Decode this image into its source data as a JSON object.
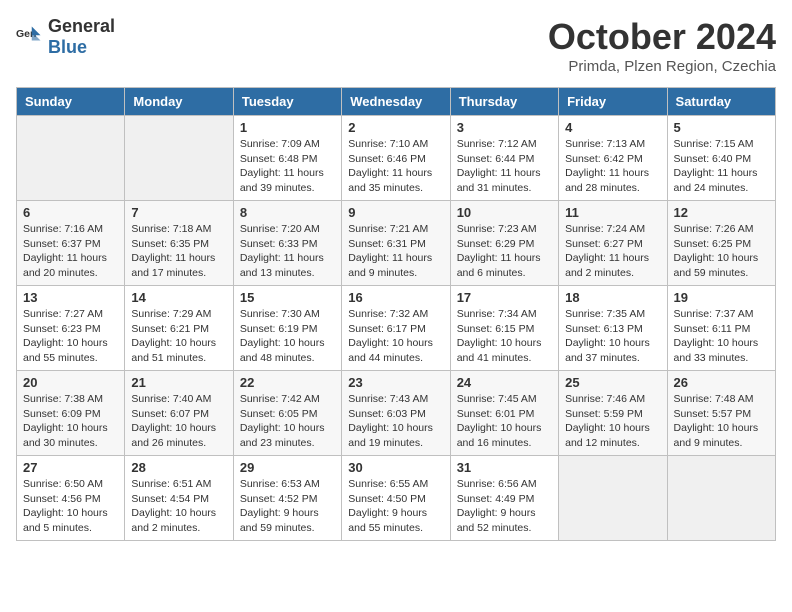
{
  "logo": {
    "general": "General",
    "blue": "Blue"
  },
  "header": {
    "title": "October 2024",
    "subtitle": "Primda, Plzen Region, Czechia"
  },
  "weekdays": [
    "Sunday",
    "Monday",
    "Tuesday",
    "Wednesday",
    "Thursday",
    "Friday",
    "Saturday"
  ],
  "weeks": [
    [
      {
        "day": "",
        "sunrise": "",
        "sunset": "",
        "daylight": ""
      },
      {
        "day": "",
        "sunrise": "",
        "sunset": "",
        "daylight": ""
      },
      {
        "day": "1",
        "sunrise": "Sunrise: 7:09 AM",
        "sunset": "Sunset: 6:48 PM",
        "daylight": "Daylight: 11 hours and 39 minutes."
      },
      {
        "day": "2",
        "sunrise": "Sunrise: 7:10 AM",
        "sunset": "Sunset: 6:46 PM",
        "daylight": "Daylight: 11 hours and 35 minutes."
      },
      {
        "day": "3",
        "sunrise": "Sunrise: 7:12 AM",
        "sunset": "Sunset: 6:44 PM",
        "daylight": "Daylight: 11 hours and 31 minutes."
      },
      {
        "day": "4",
        "sunrise": "Sunrise: 7:13 AM",
        "sunset": "Sunset: 6:42 PM",
        "daylight": "Daylight: 11 hours and 28 minutes."
      },
      {
        "day": "5",
        "sunrise": "Sunrise: 7:15 AM",
        "sunset": "Sunset: 6:40 PM",
        "daylight": "Daylight: 11 hours and 24 minutes."
      }
    ],
    [
      {
        "day": "6",
        "sunrise": "Sunrise: 7:16 AM",
        "sunset": "Sunset: 6:37 PM",
        "daylight": "Daylight: 11 hours and 20 minutes."
      },
      {
        "day": "7",
        "sunrise": "Sunrise: 7:18 AM",
        "sunset": "Sunset: 6:35 PM",
        "daylight": "Daylight: 11 hours and 17 minutes."
      },
      {
        "day": "8",
        "sunrise": "Sunrise: 7:20 AM",
        "sunset": "Sunset: 6:33 PM",
        "daylight": "Daylight: 11 hours and 13 minutes."
      },
      {
        "day": "9",
        "sunrise": "Sunrise: 7:21 AM",
        "sunset": "Sunset: 6:31 PM",
        "daylight": "Daylight: 11 hours and 9 minutes."
      },
      {
        "day": "10",
        "sunrise": "Sunrise: 7:23 AM",
        "sunset": "Sunset: 6:29 PM",
        "daylight": "Daylight: 11 hours and 6 minutes."
      },
      {
        "day": "11",
        "sunrise": "Sunrise: 7:24 AM",
        "sunset": "Sunset: 6:27 PM",
        "daylight": "Daylight: 11 hours and 2 minutes."
      },
      {
        "day": "12",
        "sunrise": "Sunrise: 7:26 AM",
        "sunset": "Sunset: 6:25 PM",
        "daylight": "Daylight: 10 hours and 59 minutes."
      }
    ],
    [
      {
        "day": "13",
        "sunrise": "Sunrise: 7:27 AM",
        "sunset": "Sunset: 6:23 PM",
        "daylight": "Daylight: 10 hours and 55 minutes."
      },
      {
        "day": "14",
        "sunrise": "Sunrise: 7:29 AM",
        "sunset": "Sunset: 6:21 PM",
        "daylight": "Daylight: 10 hours and 51 minutes."
      },
      {
        "day": "15",
        "sunrise": "Sunrise: 7:30 AM",
        "sunset": "Sunset: 6:19 PM",
        "daylight": "Daylight: 10 hours and 48 minutes."
      },
      {
        "day": "16",
        "sunrise": "Sunrise: 7:32 AM",
        "sunset": "Sunset: 6:17 PM",
        "daylight": "Daylight: 10 hours and 44 minutes."
      },
      {
        "day": "17",
        "sunrise": "Sunrise: 7:34 AM",
        "sunset": "Sunset: 6:15 PM",
        "daylight": "Daylight: 10 hours and 41 minutes."
      },
      {
        "day": "18",
        "sunrise": "Sunrise: 7:35 AM",
        "sunset": "Sunset: 6:13 PM",
        "daylight": "Daylight: 10 hours and 37 minutes."
      },
      {
        "day": "19",
        "sunrise": "Sunrise: 7:37 AM",
        "sunset": "Sunset: 6:11 PM",
        "daylight": "Daylight: 10 hours and 33 minutes."
      }
    ],
    [
      {
        "day": "20",
        "sunrise": "Sunrise: 7:38 AM",
        "sunset": "Sunset: 6:09 PM",
        "daylight": "Daylight: 10 hours and 30 minutes."
      },
      {
        "day": "21",
        "sunrise": "Sunrise: 7:40 AM",
        "sunset": "Sunset: 6:07 PM",
        "daylight": "Daylight: 10 hours and 26 minutes."
      },
      {
        "day": "22",
        "sunrise": "Sunrise: 7:42 AM",
        "sunset": "Sunset: 6:05 PM",
        "daylight": "Daylight: 10 hours and 23 minutes."
      },
      {
        "day": "23",
        "sunrise": "Sunrise: 7:43 AM",
        "sunset": "Sunset: 6:03 PM",
        "daylight": "Daylight: 10 hours and 19 minutes."
      },
      {
        "day": "24",
        "sunrise": "Sunrise: 7:45 AM",
        "sunset": "Sunset: 6:01 PM",
        "daylight": "Daylight: 10 hours and 16 minutes."
      },
      {
        "day": "25",
        "sunrise": "Sunrise: 7:46 AM",
        "sunset": "Sunset: 5:59 PM",
        "daylight": "Daylight: 10 hours and 12 minutes."
      },
      {
        "day": "26",
        "sunrise": "Sunrise: 7:48 AM",
        "sunset": "Sunset: 5:57 PM",
        "daylight": "Daylight: 10 hours and 9 minutes."
      }
    ],
    [
      {
        "day": "27",
        "sunrise": "Sunrise: 6:50 AM",
        "sunset": "Sunset: 4:56 PM",
        "daylight": "Daylight: 10 hours and 5 minutes."
      },
      {
        "day": "28",
        "sunrise": "Sunrise: 6:51 AM",
        "sunset": "Sunset: 4:54 PM",
        "daylight": "Daylight: 10 hours and 2 minutes."
      },
      {
        "day": "29",
        "sunrise": "Sunrise: 6:53 AM",
        "sunset": "Sunset: 4:52 PM",
        "daylight": "Daylight: 9 hours and 59 minutes."
      },
      {
        "day": "30",
        "sunrise": "Sunrise: 6:55 AM",
        "sunset": "Sunset: 4:50 PM",
        "daylight": "Daylight: 9 hours and 55 minutes."
      },
      {
        "day": "31",
        "sunrise": "Sunrise: 6:56 AM",
        "sunset": "Sunset: 4:49 PM",
        "daylight": "Daylight: 9 hours and 52 minutes."
      },
      {
        "day": "",
        "sunrise": "",
        "sunset": "",
        "daylight": ""
      },
      {
        "day": "",
        "sunrise": "",
        "sunset": "",
        "daylight": ""
      }
    ]
  ]
}
